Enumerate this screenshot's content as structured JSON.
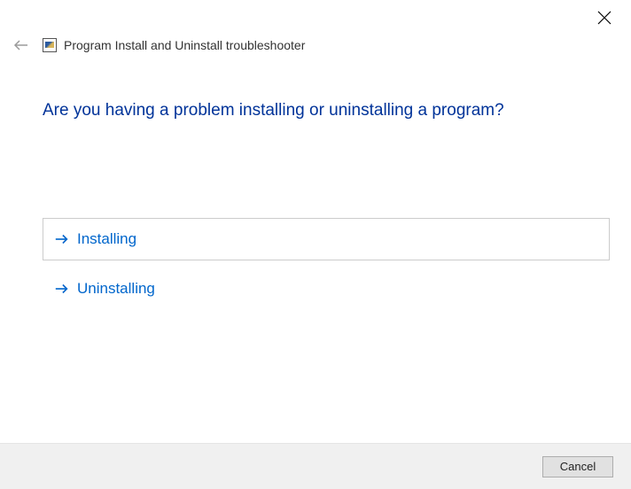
{
  "titlebar": {
    "close_label": "Close"
  },
  "header": {
    "app_title": "Program Install and Uninstall troubleshooter"
  },
  "main": {
    "question": "Are you having a problem installing or uninstalling a program?",
    "options": [
      {
        "label": "Installing"
      },
      {
        "label": "Uninstalling"
      }
    ]
  },
  "footer": {
    "cancel_label": "Cancel"
  }
}
